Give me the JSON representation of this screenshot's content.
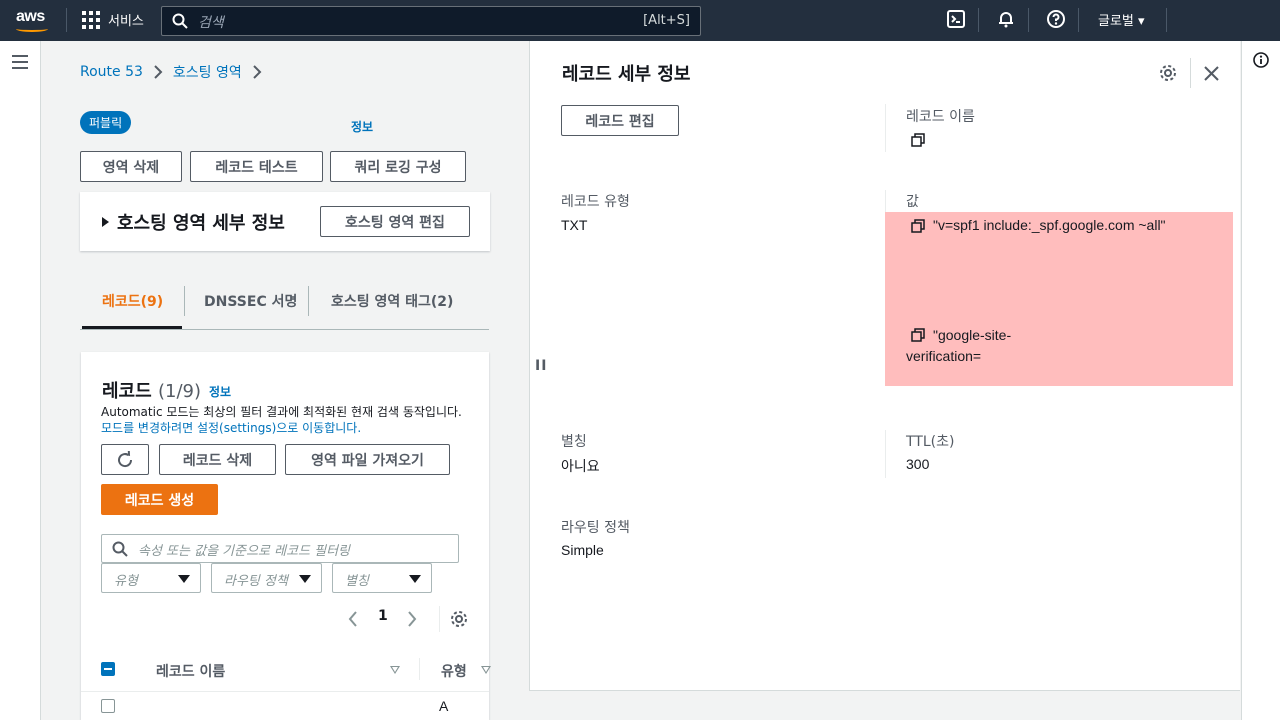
{
  "nav": {
    "logo": "aws",
    "services_label": "서비스",
    "search_placeholder": "검색",
    "search_shortcut": "[Alt+S]",
    "region_label": "글로벌 ▾"
  },
  "breadcrumb": {
    "items": [
      "Route 53",
      "호스팅 영역"
    ]
  },
  "zone": {
    "badge": "퍼블릭",
    "info": "정보",
    "buttons": {
      "delete_zone": "영역 삭제",
      "test_record": "레코드 테스트",
      "query_logging": "쿼리 로깅 구성"
    },
    "details_title": "호스팅 영역 세부 정보",
    "edit_zone": "호스팅 영역 편집"
  },
  "tabs": [
    {
      "label": "레코드(9)",
      "active": true
    },
    {
      "label": "DNSSEC 서명",
      "active": false
    },
    {
      "label": "호스팅 영역 태그(2)",
      "active": false
    }
  ],
  "records": {
    "title": "레코드",
    "count": "(1/9)",
    "info": "정보",
    "desc_1": "Automatic 모드는 최상의 필터 결과에 최적화된 현재 검색 동작입니다.",
    "desc_link": "모드를 변경하려면 설정(settings)으로 이동합니다.",
    "delete": "레코드 삭제",
    "import": "영역 파일 가져오기",
    "create": "레코드 생성",
    "filter_placeholder": "속성 또는 값을 기준으로 레코드 필터링",
    "selects": [
      "유형",
      "라우팅 정책",
      "별칭"
    ],
    "page": "1",
    "columns": [
      "레코드 이름",
      "유형"
    ],
    "row_type": "A"
  },
  "detail": {
    "title": "레코드 세부 정보",
    "edit": "레코드 편집",
    "name_label": "레코드 이름",
    "type_label": "레코드 유형",
    "type_value": "TXT",
    "value_label": "값",
    "values": [
      "\"v=spf1 include:_spf.google.com ~all\"",
      "\"google-site-",
      "verification="
    ],
    "alias_label": "별칭",
    "alias_value": "아니요",
    "ttl_label": "TTL(초)",
    "ttl_value": "300",
    "routing_label": "라우팅 정책",
    "routing_value": "Simple"
  },
  "colors": {
    "accent": "#ec7211",
    "link": "#0073bb",
    "highlight": "#ffbdbd",
    "nav": "#232f3e"
  }
}
